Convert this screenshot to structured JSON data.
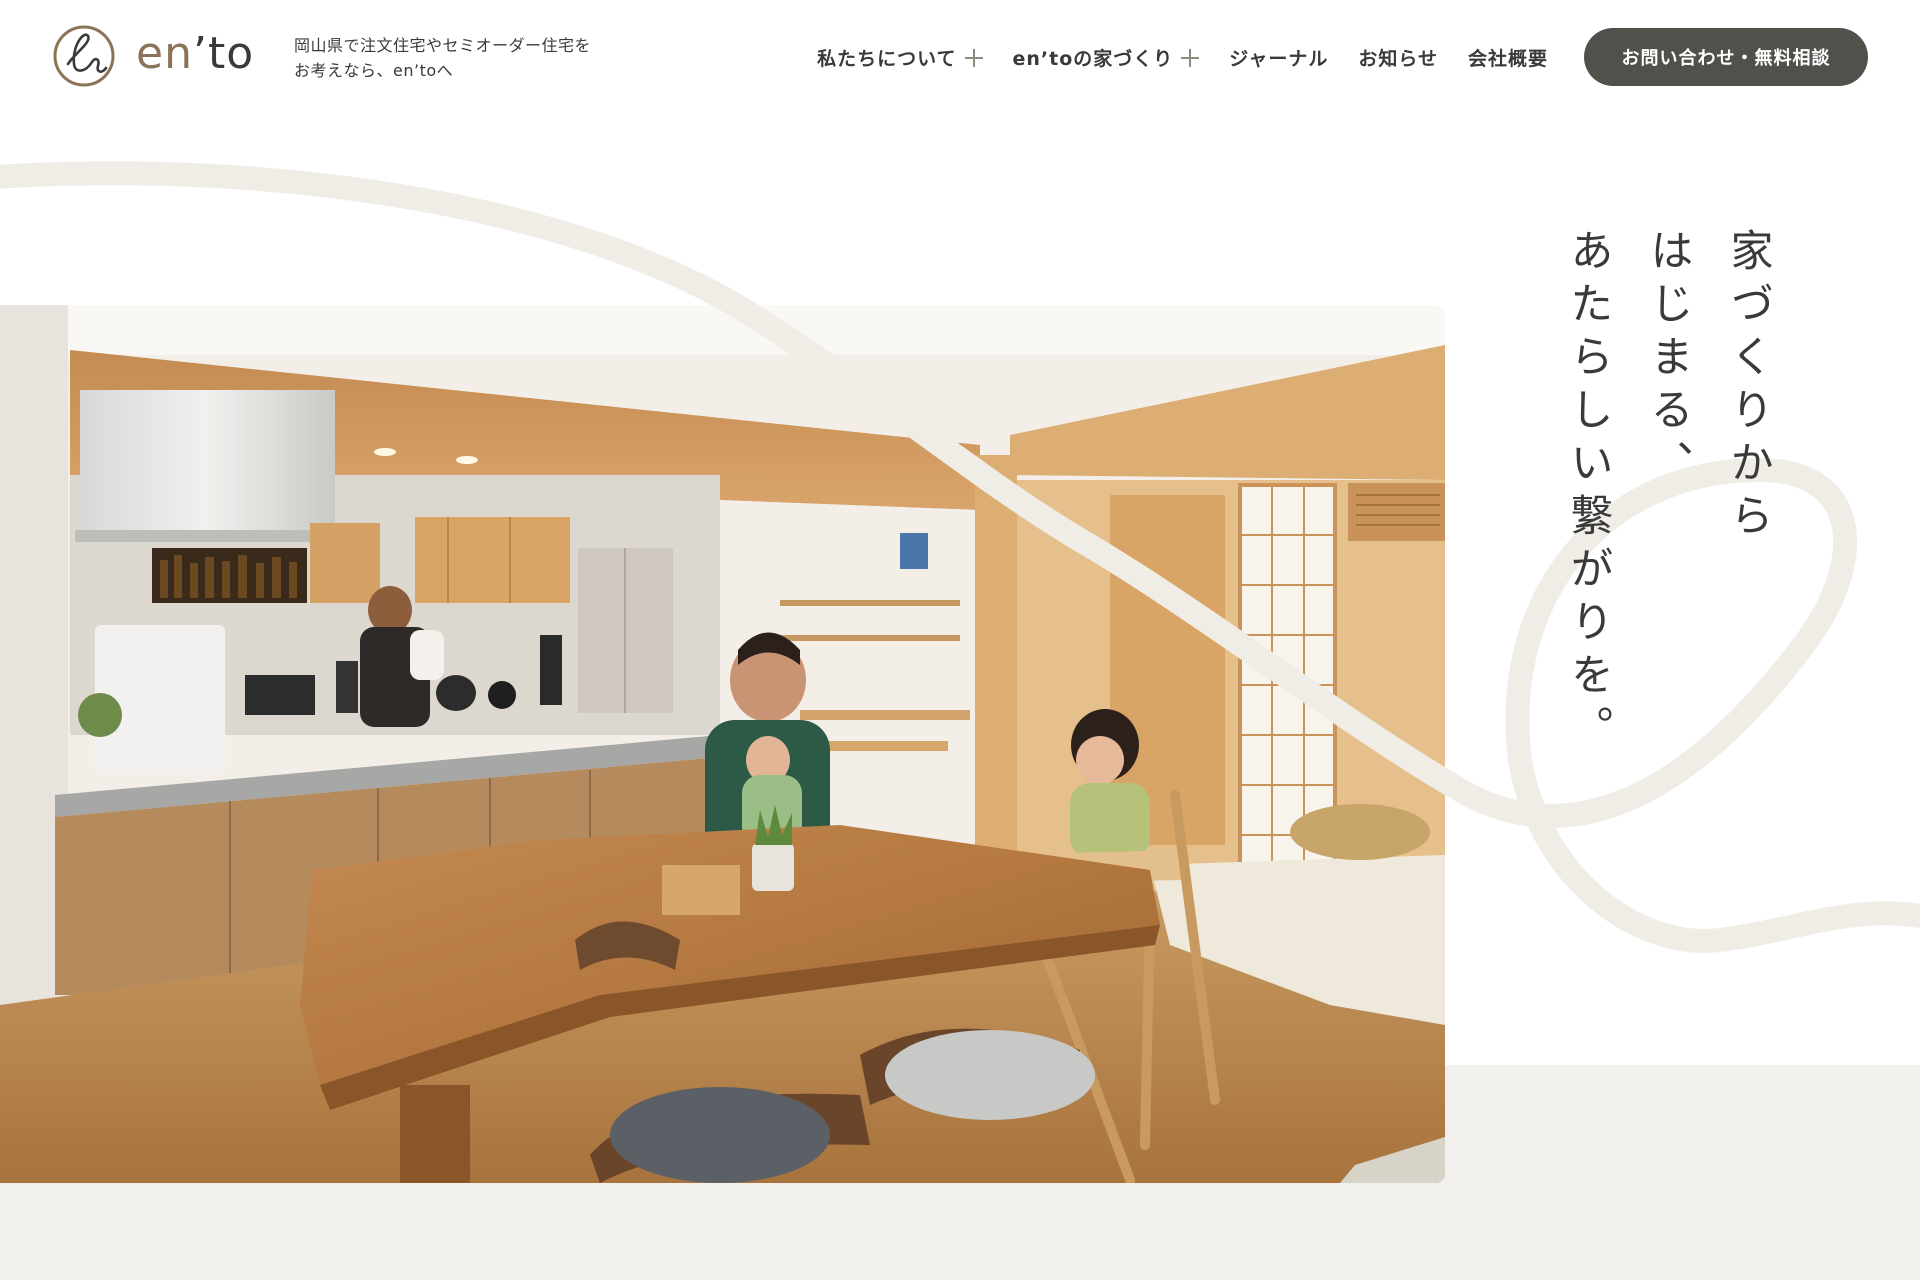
{
  "brand": {
    "logo_text_en": "en",
    "logo_text_rest": "’to",
    "tagline_line1": "岡山県で注文住宅やセミオーダー住宅を",
    "tagline_line2": "お考えなら、en’toへ",
    "logo_color": "#8a7356"
  },
  "nav": {
    "items": [
      {
        "label": "私たちについて",
        "has_submenu": true
      },
      {
        "label": "en’toの家づくり",
        "has_submenu": true
      },
      {
        "label": "ジャーナル",
        "has_submenu": false
      },
      {
        "label": "お知らせ",
        "has_submenu": false
      },
      {
        "label": "会社概要",
        "has_submenu": false
      }
    ],
    "cta_label": "お問い合わせ・無料相談",
    "cta_color": "#4e524b"
  },
  "hero": {
    "catch_line1": "家づくりから",
    "catch_line2": "はじまる、",
    "catch_line3": "あたらしい繋がりを。",
    "photo_subject": "family dining room with wooden table and open kitchen"
  },
  "colors": {
    "background": "#ffffff",
    "band": "#f2f0ec",
    "text": "#3a3a38"
  }
}
